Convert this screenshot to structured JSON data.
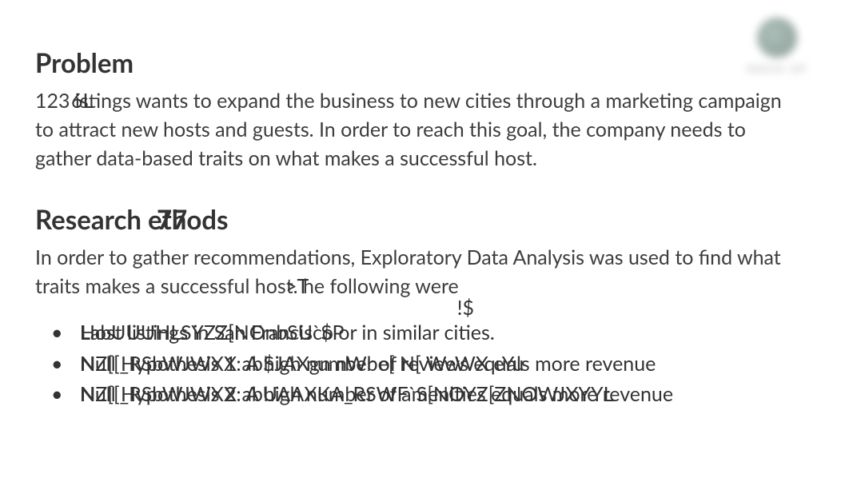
{
  "logo": {
    "text": "MOCK UP"
  },
  "sections": {
    "problem": {
      "heading": "Problem",
      "body_prefix": "123 ",
      "body_garble": "6L",
      "body_main": "istings wants to expand the business to new cities through a marketing campaign to attract new hosts and guests. In order to reach this goal, the company needs to gather data-based traits on what makes a successful host."
    },
    "methods": {
      "heading_prefix": "Research ",
      "heading_garble": "77",
      "heading_suffix": "ethods",
      "body_main": "In order to gather recommendations, Exploratory Data Analysis was used to find what traits makes a successful host. ",
      "body_garble1": ">T",
      "body_mid": "he following were",
      "body_garble2": "!$",
      "bullets": [
        {
          "lead": "L",
          "garble": "abUUUHLSYZZ[NOnbSU`$P",
          "clean": "Host listings in San Francisco or in similar cities."
        },
        {
          "lead": "N",
          "garble": "Z[[_RSbWJWXX ab$JAXgn  nWbe[ N[ WeWX eYu",
          "clean": "Null Hypothesis 1: A high number of reviews equals more revenue"
        },
        {
          "lead": "N",
          "garble": "Z[[_RSbWJWXX abUAAXKA_RSWF`S[NOYZ[ZNOWJXYYL",
          "clean": "Null Hypothesis 2: A high number of amenities equals more revenue"
        }
      ]
    }
  }
}
